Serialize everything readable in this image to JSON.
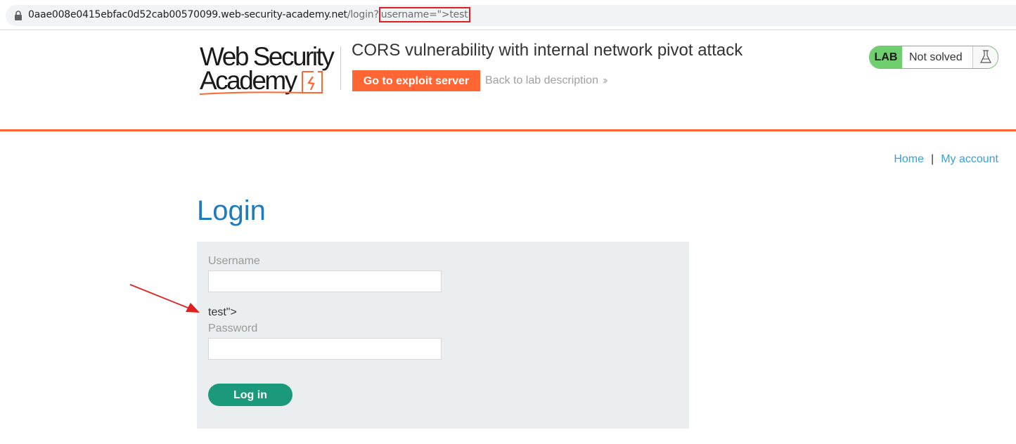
{
  "browser": {
    "url_host": "0aae008e0415ebfac0d52cab00570099.web-security-academy.net",
    "url_path": "/login?",
    "url_query": "username=\">test"
  },
  "header": {
    "logo_line1": "Web Security",
    "logo_line2": "Academy",
    "lab_title": "CORS vulnerability with internal network pivot attack",
    "exploit_button": "Go to exploit server",
    "back_link": "Back to lab description",
    "lab_badge": "LAB",
    "lab_status": "Not solved"
  },
  "nav": {
    "home": "Home",
    "separator": "|",
    "my_account": "My account"
  },
  "login": {
    "title": "Login",
    "username_label": "Username",
    "username_value": "",
    "reflected": "test\">",
    "password_label": "Password",
    "password_value": "",
    "submit": "Log in"
  },
  "colors": {
    "accent_orange": "#ff6633",
    "link_blue": "#3a9fd8",
    "title_blue": "#1f7bc0",
    "button_green": "#1a9a7a",
    "lab_green": "#6fcf6f",
    "annotation_red": "#e02020"
  }
}
